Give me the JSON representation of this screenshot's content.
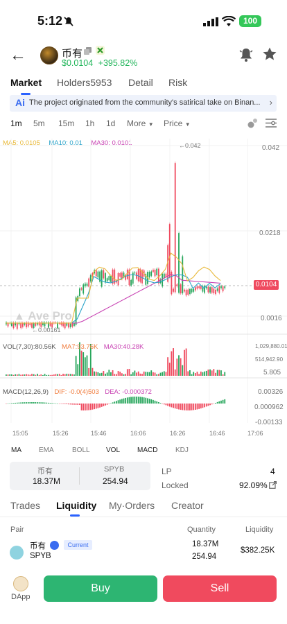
{
  "status_bar": {
    "time": "5:12",
    "battery": "100"
  },
  "header": {
    "token_name": "币有",
    "price": "$0.0104",
    "change": "+395.82%"
  },
  "main_tabs": [
    {
      "label": "Market",
      "active": true
    },
    {
      "label": "Holders5953",
      "active": false
    },
    {
      "label": "Detail",
      "active": false
    },
    {
      "label": "Risk",
      "active": false
    }
  ],
  "banner": {
    "text": "The project originated from the community's satirical take on Binan..."
  },
  "intervals": {
    "i1": "1m",
    "i2": "5m",
    "i3": "15m",
    "i4": "1h",
    "i5": "1d",
    "more": "More",
    "price": "Price"
  },
  "chart_legend": {
    "ma5": "MA5: 0.0105",
    "ma10": "MA10: 0.01",
    "ma30": "MA30: 0.0101"
  },
  "vol_legend": {
    "vol": "VOL(7,30):80.56K",
    "ma7": "MA7:93.76K",
    "ma30": "MA30:40.28K"
  },
  "macd_legend": {
    "macd": "MACD(12,26,9)",
    "dif": "DIF: -0.0(4)503",
    "dea": "DEA: -0.000372"
  },
  "watermark": "Ave Pro",
  "chart_data": {
    "type": "candlestick",
    "price_axis": [
      "0.042",
      "0.0218",
      "0.0016"
    ],
    "current_price": "0.0104",
    "high_marker": "←0.042",
    "low_marker": "←0.00161",
    "vol_axis": [
      "1,029,880.01",
      "514,942.90",
      "5.805"
    ],
    "macd_axis": [
      "0.00326",
      "0.000962",
      "-0.00133"
    ],
    "time_axis": [
      "15:05",
      "15:26",
      "15:46",
      "16:06",
      "16:26",
      "16:46",
      "17:06"
    ],
    "colors": {
      "up": "#26a65b",
      "down": "#ef4a5f",
      "ma5": "#e8b93a",
      "ma10": "#2aa3c9",
      "ma30": "#c843b3"
    }
  },
  "indicators": {
    "ma": "MA",
    "ema": "EMA",
    "boll": "BOLL",
    "vol": "VOL",
    "macd": "MACD",
    "kdj": "KDJ"
  },
  "pool": {
    "token_label": "币有",
    "token_value": "18.37M",
    "quote_label": "SPYB",
    "quote_value": "254.94"
  },
  "lp_info": {
    "lp_label": "LP",
    "lp_value": "4",
    "locked_label": "Locked",
    "locked_value": "92.09%"
  },
  "sub_tabs": [
    {
      "label": "Trades",
      "active": false
    },
    {
      "label": "Liquidity",
      "active": true
    },
    {
      "label": "My·Orders",
      "active": false
    },
    {
      "label": "Creator",
      "active": false
    }
  ],
  "table": {
    "headers": {
      "pair": "Pair",
      "quantity": "Quantity",
      "liquidity": "Liquidity"
    },
    "row": {
      "base": "币有",
      "badge": "Current",
      "quote": "SPYB",
      "qty_base": "18.37M",
      "qty_quote": "254.94",
      "liquidity": "$382.25K"
    }
  },
  "bottom": {
    "dapp": "DApp",
    "buy": "Buy",
    "sell": "Sell"
  }
}
